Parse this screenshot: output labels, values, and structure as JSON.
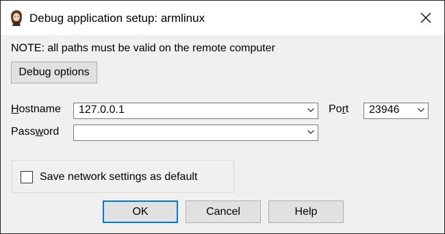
{
  "window": {
    "title": "Debug application setup: armlinux",
    "icon": "app-portrait-icon",
    "close_icon": "close-icon"
  },
  "note": "NOTE: all paths must be valid on the remote computer",
  "debug_options_button": "Debug options",
  "hostname": {
    "label_prefix": "",
    "label_mnemonic": "H",
    "label_rest": "ostname",
    "value": "127.0.0.1"
  },
  "port": {
    "label_prefix": "Po",
    "label_mnemonic": "r",
    "label_rest": "t",
    "value": "23946"
  },
  "password": {
    "label_prefix": "Pass",
    "label_mnemonic": "w",
    "label_rest": "ord",
    "value": ""
  },
  "save_settings": {
    "label": "Save network settings as default",
    "checked": false
  },
  "buttons": {
    "ok": "OK",
    "cancel": "Cancel",
    "help": "Help"
  },
  "colors": {
    "accent": "#0078d7",
    "dialog_bg": "#f0f0f0",
    "button_bg": "#e1e1e1"
  }
}
